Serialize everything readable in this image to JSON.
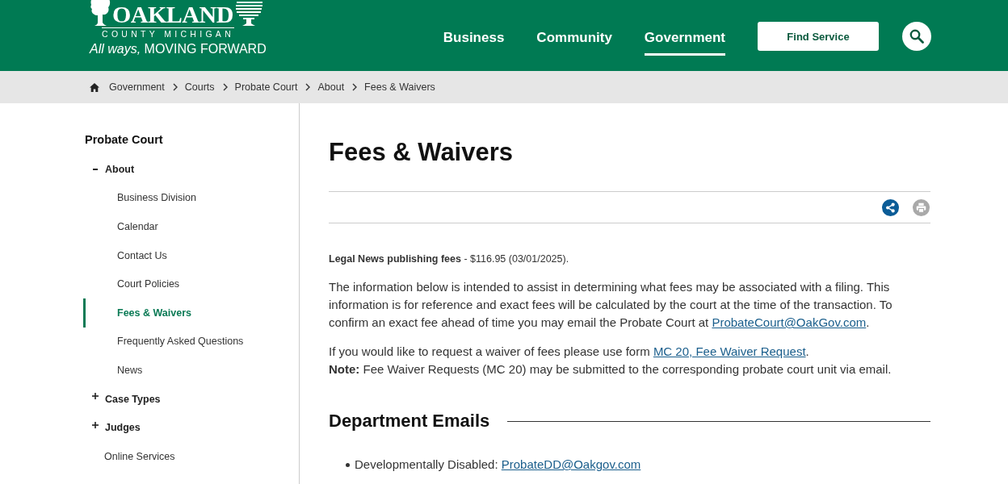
{
  "header": {
    "logo": {
      "name": "OAKLAND",
      "county": "COUNTY MICHIGAN",
      "tagline": "*All ways,* MOVING FORWARD"
    },
    "nav": [
      {
        "label": "Business",
        "selected": false
      },
      {
        "label": "Community",
        "selected": false
      },
      {
        "label": "Government",
        "selected": true
      }
    ],
    "find_service_button": "Find Service"
  },
  "breadcrumb": [
    "Government",
    "Courts",
    "Probate Court",
    "About",
    "Fees & Waivers"
  ],
  "sidebar": {
    "title": "Probate Court",
    "items": [
      {
        "kind": "group",
        "label": "About",
        "expanded": true,
        "children": [
          {
            "label": "Business Division",
            "selected": false
          },
          {
            "label": "Calendar",
            "selected": false
          },
          {
            "label": "Contact Us",
            "selected": false
          },
          {
            "label": "Court Policies",
            "selected": false
          },
          {
            "label": "Fees & Waivers",
            "selected": true
          },
          {
            "label": "Frequently Asked Questions",
            "selected": false
          },
          {
            "label": "News",
            "selected": false
          }
        ]
      },
      {
        "kind": "group",
        "label": "Case Types",
        "expanded": false
      },
      {
        "kind": "group",
        "label": "Judges",
        "expanded": false
      },
      {
        "kind": "link",
        "label": "Online Services"
      }
    ]
  },
  "content": {
    "title": "Fees & Waivers",
    "paragraphs": [
      {
        "kind": "small",
        "parts": [
          {
            "kind": "text",
            "text": "**Legal News publishing fees** - $116.95 (03/01/2025)."
          }
        ]
      },
      {
        "kind": "body",
        "parts": [
          {
            "kind": "text",
            "text": "The information below is intended to assist in determining what fees may be associated with a filing. This information is for reference and exact fees will be calculated by the court at the time of the transaction. To confirm an exact fee ahead of time you may email the Probate Court at "
          },
          {
            "kind": "link",
            "text": "ProbateCourt@OakGov.com"
          },
          {
            "kind": "text",
            "text": "."
          }
        ]
      },
      {
        "kind": "body",
        "parts": [
          {
            "kind": "text",
            "text": "If you would like to request a waiver of fees please use form "
          },
          {
            "kind": "link",
            "text": "MC 20, Fee Waiver Request"
          },
          {
            "kind": "text",
            "text": "."
          }
        ]
      },
      {
        "kind": "note",
        "parts": [
          {
            "kind": "text",
            "text": "**Note:** Fee Waiver Requests (MC 20) may be submitted to the corresponding probate court unit via email."
          }
        ]
      }
    ],
    "section": {
      "title": "Department Emails",
      "items": [
        {
          "label": "Developmentally Disabled: ",
          "email": "ProbateDD@Oakgov.com"
        }
      ]
    }
  }
}
